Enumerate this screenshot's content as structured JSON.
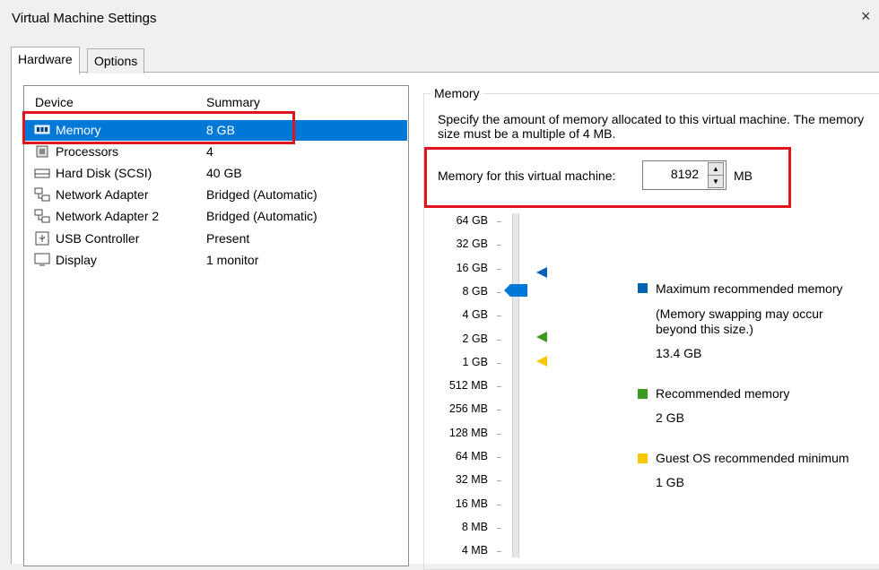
{
  "window": {
    "title": "Virtual Machine Settings",
    "close_glyph": "×"
  },
  "tabs": [
    {
      "label": "Hardware"
    },
    {
      "label": "Options"
    }
  ],
  "device_list": {
    "columns": {
      "device": "Device",
      "summary": "Summary"
    },
    "rows": [
      {
        "icon": "memory-icon",
        "name": "Memory",
        "summary": "8 GB"
      },
      {
        "icon": "processor-icon",
        "name": "Processors",
        "summary": "4"
      },
      {
        "icon": "hard-disk-icon",
        "name": "Hard Disk (SCSI)",
        "summary": "40 GB"
      },
      {
        "icon": "network-adapter-icon",
        "name": "Network Adapter",
        "summary": "Bridged (Automatic)"
      },
      {
        "icon": "network-adapter-icon",
        "name": "Network Adapter 2",
        "summary": "Bridged (Automatic)"
      },
      {
        "icon": "usb-icon",
        "name": "USB Controller",
        "summary": "Present"
      },
      {
        "icon": "display-icon",
        "name": "Display",
        "summary": "1 monitor"
      }
    ],
    "selected_index": 0
  },
  "memory": {
    "group_label": "Memory",
    "description": "Specify the amount of memory allocated to this virtual machine. The memory size must be a multiple of 4 MB.",
    "field_label": "Memory for this virtual machine:",
    "value": "8192",
    "unit": "MB",
    "slider_ticks": [
      "64 GB",
      "32 GB",
      "16 GB",
      "8 GB",
      "4 GB",
      "2 GB",
      "1 GB",
      "512 MB",
      "256 MB",
      "128 MB",
      "64 MB",
      "32 MB",
      "16 MB",
      "8 MB",
      "4 MB"
    ],
    "slider_value": "8 GB",
    "legend": {
      "max": {
        "label": "Maximum recommended memory",
        "note": "(Memory swapping may occur beyond this size.)",
        "value": "13.4 GB",
        "color": "#0063b1"
      },
      "recommended": {
        "label": "Recommended memory",
        "value": "2 GB",
        "color": "#3b9a1e"
      },
      "guest_min": {
        "label": "Guest OS recommended minimum",
        "value": "1 GB",
        "color": "#f5c800"
      }
    }
  },
  "colors": {
    "selection": "#0078d7",
    "highlight": "#e1141e"
  }
}
